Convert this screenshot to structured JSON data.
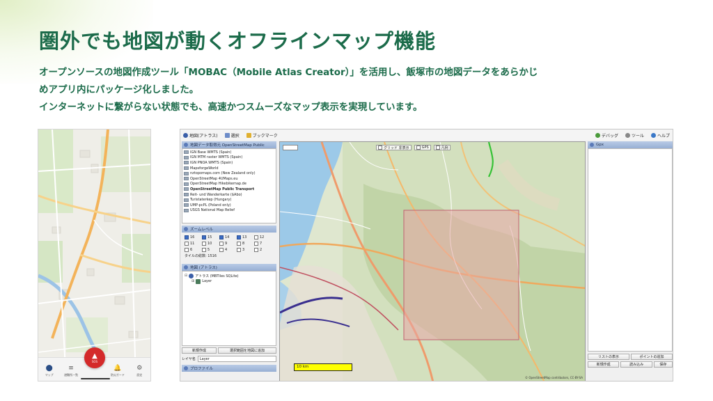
{
  "title": "圏外でも地図が動くオフラインマップ機能",
  "description": [
    "オープンソースの地図作成ツール「MOBAC（Mobile Atlas Creator）」を活用し、飯塚市の地図データをあらかじ",
    "めアプリ内にパッケージ化しました。",
    "インターネットに繋がらない状態でも、高速かつスムーズなマップ表示を実現しています。"
  ],
  "phone": {
    "nav": [
      {
        "icon": "map-pin-icon",
        "glyph": "⬤",
        "label": "マップ",
        "active": true
      },
      {
        "icon": "list-icon",
        "glyph": "≡",
        "label": "避難所一覧",
        "active": false
      },
      {
        "icon": "bell-icon",
        "glyph": "🔔",
        "label": "防災ガード",
        "active": false
      },
      {
        "icon": "gear-icon",
        "glyph": "⚙",
        "label": "設定",
        "active": false
      }
    ],
    "sos_label": "SOS",
    "sos_glyph": "▲"
  },
  "mobac": {
    "menu": {
      "atlas": "地図(アトラス)",
      "select": "選択",
      "bookmark": "ブックマーク",
      "debug": "デバッグ",
      "tools": "ツール",
      "help": "ヘルプ"
    },
    "source_panel_title": "地図データ取得元 OpenStreetMap Public",
    "sources": [
      "IGN Base WMTS (Spain)",
      "IGN MTM raster WMTS (Spain)",
      "IGN PNOA WMTS (Spain)",
      "MapsforgeWorld",
      "nztopomaps.com (New Zealand only)",
      "OpenStreetMap 4UMaps.eu",
      "OpenStreetMap Hikebikemap.de",
      "OpenStreetMap Public Transport",
      "Reit- und Wanderkarte ($Abo)",
      "Turistaterkep (Hungary)",
      "UMP-pcPL (Poland only)",
      "USGS National Map Relief"
    ],
    "selected_source_index": 7,
    "zoom_panel_title": "ズームレベル",
    "zoom_levels": [
      {
        "level": "16",
        "checked": true
      },
      {
        "level": "15",
        "checked": true
      },
      {
        "level": "14",
        "checked": true
      },
      {
        "level": "13",
        "checked": true
      },
      {
        "level": "12",
        "checked": false
      },
      {
        "level": "11",
        "checked": false
      },
      {
        "level": "10",
        "checked": false
      },
      {
        "level": "9",
        "checked": false
      },
      {
        "level": "8",
        "checked": false
      },
      {
        "level": "7",
        "checked": false
      },
      {
        "level": "6",
        "checked": false
      },
      {
        "level": "5",
        "checked": false
      },
      {
        "level": "4",
        "checked": false
      },
      {
        "level": "3",
        "checked": false
      },
      {
        "level": "2",
        "checked": false
      }
    ],
    "tile_count": "タイルの総数: 1516",
    "atlas_panel_title": "地図 (アトラス)",
    "atlas_tree": {
      "root": "アトラス (MBTiles SQLite)",
      "child": "Layer"
    },
    "btn_new": "新規作成",
    "btn_add_area": "選択範囲を地図に追加",
    "layer_label": "レイヤ名",
    "layer_value": "Layer",
    "profile_panel_title": "プロファイル",
    "gpx_panel_title": "Gpx",
    "right_buttons": [
      "リストの表示",
      "ポイントの追加",
      "新規作成",
      "読み込み",
      "保存"
    ],
    "map_toolbar": [
      "グリッド 非表示",
      "GPS",
      "凡例"
    ],
    "scale_label": "10 km",
    "attribution": "© OpenStreetMap contributors, CC-BY-SA"
  }
}
